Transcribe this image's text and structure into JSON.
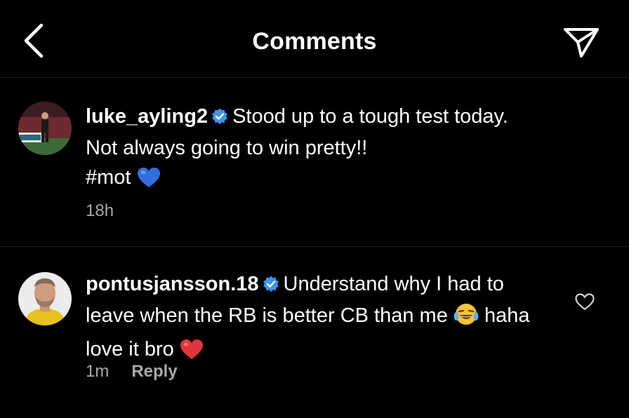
{
  "header": {
    "title": "Comments",
    "back_icon": "chevron-left-icon",
    "share_icon": "paper-plane-icon"
  },
  "caption": {
    "username": "luke_ayling2",
    "verified": true,
    "text_line1": "Stood up to a tough test today.",
    "text_line2": "Not always going to win pretty!!",
    "text_line3": "#mot",
    "emoji": "blue-heart",
    "time": "18h"
  },
  "reply": {
    "username": "pontusjansson.18",
    "verified": true,
    "text_part1": "Understand why I had to leave when the RB is better CB than me",
    "emoji1": "face-with-tears-of-joy",
    "text_part2": "haha love it bro",
    "emoji2": "red-heart",
    "time": "1m",
    "reply_label": "Reply",
    "like_icon": "heart-outline-icon"
  },
  "colors": {
    "background": "#000000",
    "text": "#ffffff",
    "meta": "#a8a8a8",
    "verified": "#3897f0",
    "divider": "#1c1c1c"
  }
}
